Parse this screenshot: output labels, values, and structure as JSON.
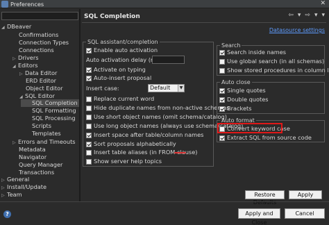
{
  "window": {
    "title": "Preferences",
    "close": "✕"
  },
  "tree": {
    "items": [
      {
        "label": "DBeaver",
        "arrow": "◢"
      },
      {
        "label": "Confirmations"
      },
      {
        "label": "Connection Types"
      },
      {
        "label": "Connections"
      },
      {
        "label": "Drivers",
        "arrow": "▷"
      },
      {
        "label": "Editors",
        "arrow": "◢"
      },
      {
        "label": "Data Editor",
        "arrow": "▷"
      },
      {
        "label": "ERD Editor"
      },
      {
        "label": "Object Editor"
      },
      {
        "label": "SQL Editor",
        "arrow": "◢"
      },
      {
        "label": "SQL Completion"
      },
      {
        "label": "SQL Formatting"
      },
      {
        "label": "SQL Processing"
      },
      {
        "label": "Scripts"
      },
      {
        "label": "Templates"
      },
      {
        "label": "Errors and Timeouts",
        "arrow": "▷"
      },
      {
        "label": "Metadata"
      },
      {
        "label": "Navigator"
      },
      {
        "label": "Query Manager"
      },
      {
        "label": "Transactions"
      },
      {
        "label": "General",
        "arrow": "▷"
      },
      {
        "label": "Install/Update",
        "arrow": "▷"
      },
      {
        "label": "Team",
        "arrow": "▷"
      }
    ]
  },
  "page": {
    "title": "SQL Completion",
    "datasource_link": "Datasource settings",
    "nav": {
      "back": "⇦",
      "back_menu": "▾",
      "forward": "⇨",
      "forward_menu": "▾",
      "menu": "▾"
    }
  },
  "assist": {
    "legend": "SQL assistant/completion",
    "enable_auto_activation": "Enable auto activation",
    "delay_label": "Auto activation delay (ms):",
    "activate_on_typing": "Activate on typing",
    "auto_insert": "Auto-insert proposal",
    "insert_case_label": "Insert case:",
    "insert_case_value": "Default",
    "replace_current_word": "Replace current word",
    "hide_duplicates": "Hide duplicate names from non-active schemas",
    "short_object_names": "Use short object names (omit schema/catalog)",
    "long_object_names": "Use long object names (always use schema/catalog)",
    "insert_space": "Insert space after table/column names",
    "sort_alpha": "Sort proposals alphabetically",
    "table_aliases": "Insert table aliases (in FROM clause)",
    "server_help": "Show server help topics"
  },
  "search": {
    "legend": "Search",
    "search_inside": "Search inside names",
    "global_search": "Use global search (in all schemas)",
    "stored_procs": "Show stored procedures in column list"
  },
  "auto_close": {
    "legend": "Auto close",
    "single_quotes": "Single quotes",
    "double_quotes": "Double quotes",
    "brackets": "Brackets"
  },
  "auto_format": {
    "legend": "Auto format",
    "convert_case": "Convert keyword case",
    "extract_sql": "Extract SQL from source code"
  },
  "buttons": {
    "restore_defaults": "Restore Defaults",
    "apply": "Apply",
    "apply_close": "Apply and Close",
    "cancel": "Cancel"
  },
  "icons": {
    "help": "?"
  }
}
